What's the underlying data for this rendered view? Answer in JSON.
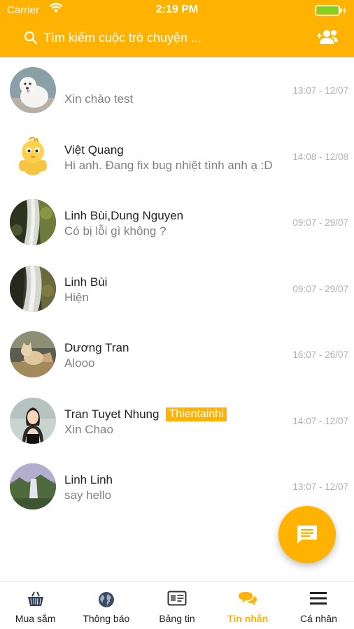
{
  "status_bar": {
    "carrier": "Carrier",
    "time": "2:19 PM"
  },
  "search": {
    "placeholder": "Tìm kiếm cuộc trò chuyện ..."
  },
  "conversations": [
    {
      "name": "",
      "preview": "Xin chào test",
      "time": "13:07 - 12/07",
      "avatar": "white-dog-avatar"
    },
    {
      "name": "Việt Quang",
      "preview": "Hi anh. Đang fix bug nhiệt tình anh ạ :D",
      "time": "14:08 - 12/08",
      "avatar": "chick-avatar"
    },
    {
      "name": "Linh Bùi,Dung Nguyen",
      "preview": "Có bị lỗi gì không ?",
      "time": "09:07 - 29/07",
      "avatar": "waterfall-avatar"
    },
    {
      "name": "Linh Bùi",
      "preview": "Hiện",
      "time": "09:07 - 29/07",
      "avatar": "waterfall-avatar"
    },
    {
      "name": "Dương Tran",
      "preview": "Alooo",
      "time": "16:07 - 26/07",
      "avatar": "cat-avatar"
    },
    {
      "name": "Tran Tuyet Nhung",
      "tag": "Thientainhi",
      "preview": "Xin Chao",
      "time": "14:07 - 12/07",
      "avatar": "woman-avatar"
    },
    {
      "name": "Linh Linh",
      "preview": "say hello",
      "time": "13:07 - 12/07",
      "avatar": "landscape-avatar"
    }
  ],
  "fab": {
    "icon": "chat-icon"
  },
  "bottom_nav": [
    {
      "label": "Mua sắm",
      "icon": "basket-icon",
      "active": false
    },
    {
      "label": "Thông báo",
      "icon": "globe-icon",
      "active": false
    },
    {
      "label": "Bảng tin",
      "icon": "id-card-icon",
      "active": false
    },
    {
      "label": "Tin nhắn",
      "icon": "chat-bubbles-icon",
      "active": true
    },
    {
      "label": "Cá nhân",
      "icon": "menu-icon",
      "active": false
    }
  ],
  "colors": {
    "accent": "#ffb300",
    "preview_text": "#808080",
    "time_text": "#b0b0b0"
  }
}
